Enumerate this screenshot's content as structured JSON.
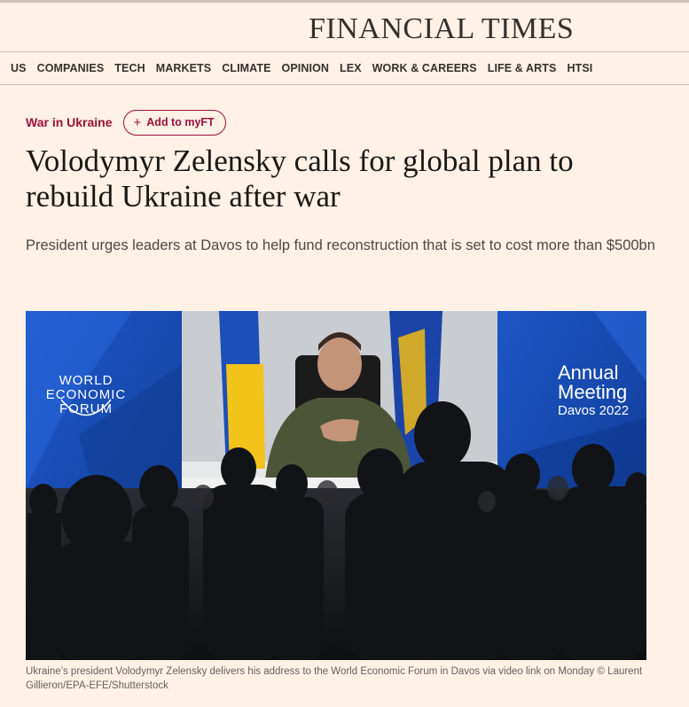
{
  "masthead": {
    "logo": "FINANCIAL TIMES"
  },
  "nav": {
    "items": [
      "US",
      "COMPANIES",
      "TECH",
      "MARKETS",
      "CLIMATE",
      "OPINION",
      "LEX",
      "WORK & CAREERS",
      "LIFE & ARTS",
      "HTSI"
    ]
  },
  "article": {
    "topic": "War in Ukraine",
    "myft_label": "Add to myFT",
    "headline": "Volodymyr Zelensky calls for global plan to rebuild Ukraine after war",
    "standfirst": "President urges leaders at Davos to help fund reconstruction that is set to cost more than $500bn",
    "image": {
      "wef_logo_lines": [
        "WORLD",
        "ECONOMIC",
        "FORUM"
      ],
      "annual_meeting_lines": [
        "Annual",
        "Meeting",
        "Davos 2022"
      ]
    },
    "caption": "Ukraine’s president Volodymyr Zelensky delivers his address to the World Economic Forum in Davos via video link on Monday © Laurent Gillieron/EPA-EFE/Shutterstock"
  },
  "colors": {
    "background": "#fff1e5",
    "accent": "#990f3d",
    "text": "#33302e"
  }
}
